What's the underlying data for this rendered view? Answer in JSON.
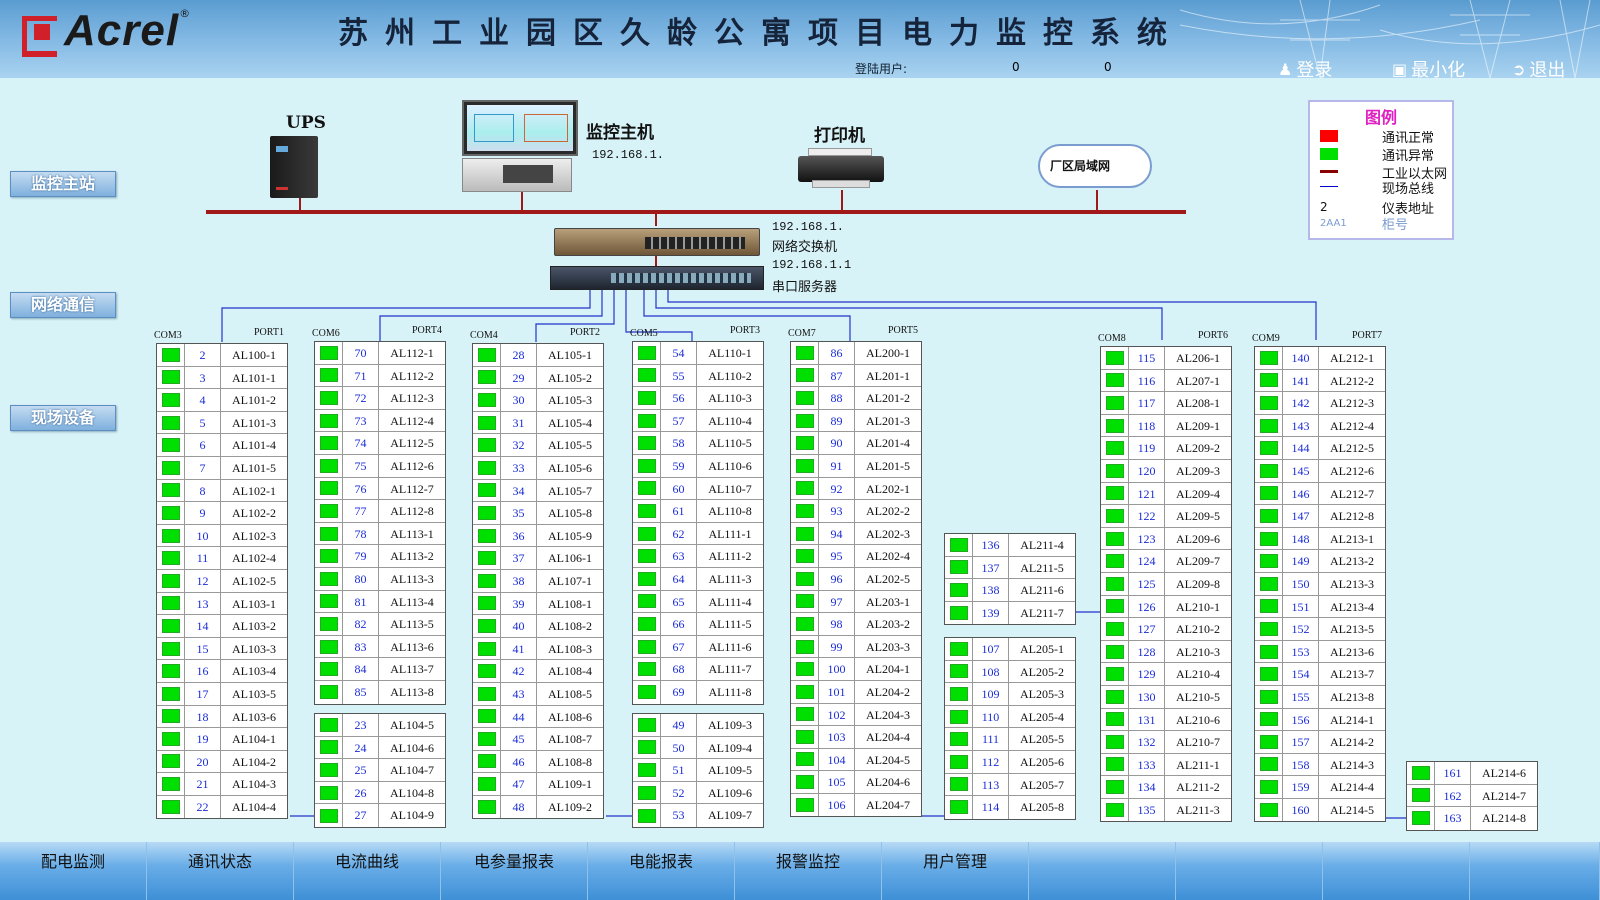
{
  "header": {
    "brand": "Acrel",
    "reg": "®",
    "title": "苏州工业园区久龄公寓项目电力监控系统",
    "login_user_label": "登陆用户:",
    "value_1": "0",
    "value_2": "0",
    "login_label": "登录",
    "minimize_label": "最小化",
    "exit_label": "退出"
  },
  "sidebar": {
    "master_station": "监控主站",
    "network": "网络通信",
    "field_devices": "现场设备"
  },
  "topology": {
    "ups_label": "UPS",
    "host_label": "监控主机",
    "host_ip": "192.168.1.",
    "printer_label": "打印机",
    "lan_label": "厂区局域网",
    "switch_ip": "192.168.1.",
    "switch_label": "网络交换机",
    "serial_ip": "192.168.1.1",
    "serial_label": "串口服务器"
  },
  "legend": {
    "title": "图例",
    "items": [
      {
        "label": "通讯正常",
        "color": "#ff0000"
      },
      {
        "label": "通讯异常",
        "color": "#00e000"
      },
      {
        "label": "工业以太网",
        "color": "#8b0000"
      },
      {
        "label": "现场总线",
        "color": "#0000cc"
      },
      {
        "label": "仪表地址",
        "sample": "2"
      },
      {
        "label": "柜号",
        "sample": "2AA1"
      }
    ]
  },
  "groups": [
    {
      "com": "COM3",
      "port": "PORT1",
      "devices": [
        [
          "2",
          "AL100-1"
        ],
        [
          "3",
          "AL101-1"
        ],
        [
          "4",
          "AL101-2"
        ],
        [
          "5",
          "AL101-3"
        ],
        [
          "6",
          "AL101-4"
        ],
        [
          "7",
          "AL101-5"
        ],
        [
          "8",
          "AL102-1"
        ],
        [
          "9",
          "AL102-2"
        ],
        [
          "10",
          "AL102-3"
        ],
        [
          "11",
          "AL102-4"
        ],
        [
          "12",
          "AL102-5"
        ],
        [
          "13",
          "AL103-1"
        ],
        [
          "14",
          "AL103-2"
        ],
        [
          "15",
          "AL103-3"
        ],
        [
          "16",
          "AL103-4"
        ],
        [
          "17",
          "AL103-5"
        ],
        [
          "18",
          "AL103-6"
        ],
        [
          "19",
          "AL104-1"
        ],
        [
          "20",
          "AL104-2"
        ],
        [
          "21",
          "AL104-3"
        ],
        [
          "22",
          "AL104-4"
        ]
      ]
    },
    {
      "com": "COM6",
      "port": "PORT4",
      "devices": [
        [
          "70",
          "AL112-1"
        ],
        [
          "71",
          "AL112-2"
        ],
        [
          "72",
          "AL112-3"
        ],
        [
          "73",
          "AL112-4"
        ],
        [
          "74",
          "AL112-5"
        ],
        [
          "75",
          "AL112-6"
        ],
        [
          "76",
          "AL112-7"
        ],
        [
          "77",
          "AL112-8"
        ],
        [
          "78",
          "AL113-1"
        ],
        [
          "79",
          "AL113-2"
        ],
        [
          "80",
          "AL113-3"
        ],
        [
          "81",
          "AL113-4"
        ],
        [
          "82",
          "AL113-5"
        ],
        [
          "83",
          "AL113-6"
        ],
        [
          "84",
          "AL113-7"
        ],
        [
          "85",
          "AL113-8"
        ]
      ],
      "devices2": [
        [
          "23",
          "AL104-5"
        ],
        [
          "24",
          "AL104-6"
        ],
        [
          "25",
          "AL104-7"
        ],
        [
          "26",
          "AL104-8"
        ],
        [
          "27",
          "AL104-9"
        ]
      ]
    },
    {
      "com": "COM4",
      "port": "PORT2",
      "devices": [
        [
          "28",
          "AL105-1"
        ],
        [
          "29",
          "AL105-2"
        ],
        [
          "30",
          "AL105-3"
        ],
        [
          "31",
          "AL105-4"
        ],
        [
          "32",
          "AL105-5"
        ],
        [
          "33",
          "AL105-6"
        ],
        [
          "34",
          "AL105-7"
        ],
        [
          "35",
          "AL105-8"
        ],
        [
          "36",
          "AL105-9"
        ],
        [
          "37",
          "AL106-1"
        ],
        [
          "38",
          "AL107-1"
        ],
        [
          "39",
          "AL108-1"
        ],
        [
          "40",
          "AL108-2"
        ],
        [
          "41",
          "AL108-3"
        ],
        [
          "42",
          "AL108-4"
        ],
        [
          "43",
          "AL108-5"
        ],
        [
          "44",
          "AL108-6"
        ],
        [
          "45",
          "AL108-7"
        ],
        [
          "46",
          "AL108-8"
        ],
        [
          "47",
          "AL109-1"
        ],
        [
          "48",
          "AL109-2"
        ]
      ]
    },
    {
      "com": "COM5",
      "port": "PORT3",
      "devices": [
        [
          "54",
          "AL110-1"
        ],
        [
          "55",
          "AL110-2"
        ],
        [
          "56",
          "AL110-3"
        ],
        [
          "57",
          "AL110-4"
        ],
        [
          "58",
          "AL110-5"
        ],
        [
          "59",
          "AL110-6"
        ],
        [
          "60",
          "AL110-7"
        ],
        [
          "61",
          "AL110-8"
        ],
        [
          "62",
          "AL111-1"
        ],
        [
          "63",
          "AL111-2"
        ],
        [
          "64",
          "AL111-3"
        ],
        [
          "65",
          "AL111-4"
        ],
        [
          "66",
          "AL111-5"
        ],
        [
          "67",
          "AL111-6"
        ],
        [
          "68",
          "AL111-7"
        ],
        [
          "69",
          "AL111-8"
        ]
      ],
      "devices2": [
        [
          "49",
          "AL109-3"
        ],
        [
          "50",
          "AL109-4"
        ],
        [
          "51",
          "AL109-5"
        ],
        [
          "52",
          "AL109-6"
        ],
        [
          "53",
          "AL109-7"
        ]
      ]
    },
    {
      "com": "COM7",
      "port": "PORT5",
      "devices": [
        [
          "86",
          "AL200-1"
        ],
        [
          "87",
          "AL201-1"
        ],
        [
          "88",
          "AL201-2"
        ],
        [
          "89",
          "AL201-3"
        ],
        [
          "90",
          "AL201-4"
        ],
        [
          "91",
          "AL201-5"
        ],
        [
          "92",
          "AL202-1"
        ],
        [
          "93",
          "AL202-2"
        ],
        [
          "94",
          "AL202-3"
        ],
        [
          "95",
          "AL202-4"
        ],
        [
          "96",
          "AL202-5"
        ],
        [
          "97",
          "AL203-1"
        ],
        [
          "98",
          "AL203-2"
        ],
        [
          "99",
          "AL203-3"
        ],
        [
          "100",
          "AL204-1"
        ],
        [
          "101",
          "AL204-2"
        ],
        [
          "102",
          "AL204-3"
        ],
        [
          "103",
          "AL204-4"
        ],
        [
          "104",
          "AL204-5"
        ],
        [
          "105",
          "AL204-6"
        ],
        [
          "106",
          "AL204-7"
        ]
      ]
    },
    {
      "com": "",
      "port": "",
      "devices": [
        [
          "136",
          "AL211-4"
        ],
        [
          "137",
          "AL211-5"
        ],
        [
          "138",
          "AL211-6"
        ],
        [
          "139",
          "AL211-7"
        ]
      ],
      "devices2": [
        [
          "107",
          "AL205-1"
        ],
        [
          "108",
          "AL205-2"
        ],
        [
          "109",
          "AL205-3"
        ],
        [
          "110",
          "AL205-4"
        ],
        [
          "111",
          "AL205-5"
        ],
        [
          "112",
          "AL205-6"
        ],
        [
          "113",
          "AL205-7"
        ],
        [
          "114",
          "AL205-8"
        ]
      ]
    },
    {
      "com": "COM8",
      "port": "PORT6",
      "devices": [
        [
          "115",
          "AL206-1"
        ],
        [
          "116",
          "AL207-1"
        ],
        [
          "117",
          "AL208-1"
        ],
        [
          "118",
          "AL209-1"
        ],
        [
          "119",
          "AL209-2"
        ],
        [
          "120",
          "AL209-3"
        ],
        [
          "121",
          "AL209-4"
        ],
        [
          "122",
          "AL209-5"
        ],
        [
          "123",
          "AL209-6"
        ],
        [
          "124",
          "AL209-7"
        ],
        [
          "125",
          "AL209-8"
        ],
        [
          "126",
          "AL210-1"
        ],
        [
          "127",
          "AL210-2"
        ],
        [
          "128",
          "AL210-3"
        ],
        [
          "129",
          "AL210-4"
        ],
        [
          "130",
          "AL210-5"
        ],
        [
          "131",
          "AL210-6"
        ],
        [
          "132",
          "AL210-7"
        ],
        [
          "133",
          "AL211-1"
        ],
        [
          "134",
          "AL211-2"
        ],
        [
          "135",
          "AL211-3"
        ]
      ]
    },
    {
      "com": "COM9",
      "port": "PORT7",
      "devices": [
        [
          "140",
          "AL212-1"
        ],
        [
          "141",
          "AL212-2"
        ],
        [
          "142",
          "AL212-3"
        ],
        [
          "143",
          "AL212-4"
        ],
        [
          "144",
          "AL212-5"
        ],
        [
          "145",
          "AL212-6"
        ],
        [
          "146",
          "AL212-7"
        ],
        [
          "147",
          "AL212-8"
        ],
        [
          "148",
          "AL213-1"
        ],
        [
          "149",
          "AL213-2"
        ],
        [
          "150",
          "AL213-3"
        ],
        [
          "151",
          "AL213-4"
        ],
        [
          "152",
          "AL213-5"
        ],
        [
          "153",
          "AL213-6"
        ],
        [
          "154",
          "AL213-7"
        ],
        [
          "155",
          "AL213-8"
        ],
        [
          "156",
          "AL214-1"
        ],
        [
          "157",
          "AL214-2"
        ],
        [
          "158",
          "AL214-3"
        ],
        [
          "159",
          "AL214-4"
        ],
        [
          "160",
          "AL214-5"
        ]
      ]
    },
    {
      "com": "",
      "port": "",
      "devices": [
        [
          "161",
          "AL214-6"
        ],
        [
          "162",
          "AL214-7"
        ],
        [
          "163",
          "AL214-8"
        ]
      ]
    }
  ],
  "bottom_tabs": [
    "配电监测",
    "通讯状态",
    "电流曲线",
    "电参量报表",
    "电能报表",
    "报警监控",
    "用户管理",
    "",
    "",
    "",
    ""
  ]
}
